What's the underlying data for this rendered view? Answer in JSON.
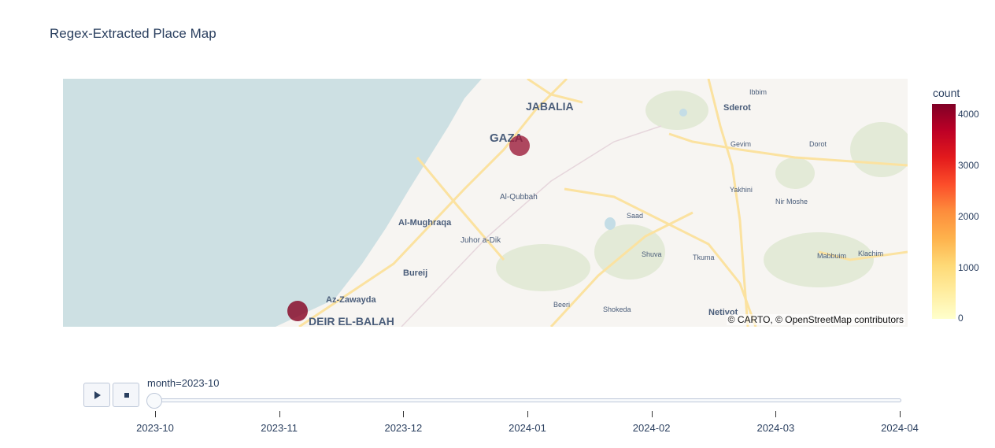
{
  "title": "Regex-Extracted Place Map",
  "map": {
    "attribution": "© CARTO, © OpenStreetMap contributors",
    "place_labels": [
      {
        "name": "JABALIA",
        "class": "city"
      },
      {
        "name": "GAZA",
        "class": "city-major"
      },
      {
        "name": "DEIR EL-BALAH",
        "class": "city"
      },
      {
        "name": "Al-Qubbah",
        "class": "town"
      },
      {
        "name": "Al-Mughraqa",
        "class": "town-medium"
      },
      {
        "name": "Juhor a-Dik",
        "class": "town"
      },
      {
        "name": "Bureij",
        "class": "town-medium"
      },
      {
        "name": "Az-Zawayda",
        "class": "town-medium"
      },
      {
        "name": "Sderot",
        "class": "town-medium"
      },
      {
        "name": "Ibbim",
        "class": "village"
      },
      {
        "name": "Gevim",
        "class": "village"
      },
      {
        "name": "Dorot",
        "class": "village"
      },
      {
        "name": "Yakhini",
        "class": "village"
      },
      {
        "name": "Nir Moshe",
        "class": "village"
      },
      {
        "name": "Saad",
        "class": "village"
      },
      {
        "name": "Shuva",
        "class": "village"
      },
      {
        "name": "Tkuma",
        "class": "village"
      },
      {
        "name": "Mabbuim",
        "class": "village"
      },
      {
        "name": "Klachim",
        "class": "village"
      },
      {
        "name": "Beeri",
        "class": "village"
      },
      {
        "name": "Shokeda",
        "class": "village"
      },
      {
        "name": "Netivot",
        "class": "town-medium"
      }
    ],
    "markers": [
      {
        "place": "GAZA",
        "count": 3300,
        "color": "#9b1b3a"
      },
      {
        "place": "DEIR EL-BALAH",
        "count": 4200,
        "color": "#85001f"
      }
    ],
    "colors": {
      "sea": "#cde0e3",
      "land": "#f7f5f2",
      "road": "#fbe2a0",
      "label": "#4a5d7a"
    }
  },
  "colorbar": {
    "title": "count",
    "ticks": [
      "4000",
      "3000",
      "2000",
      "1000",
      "0"
    ],
    "range": [
      0,
      4200
    ],
    "colorscale": "YlOrRd"
  },
  "slider": {
    "current_label": "month=2023-10",
    "months": [
      "2023-10",
      "2023-11",
      "2023-12",
      "2024-01",
      "2024-02",
      "2024-03",
      "2024-04"
    ],
    "selected_index": 0,
    "play_icon": "play-icon",
    "stop_icon": "stop-icon"
  }
}
